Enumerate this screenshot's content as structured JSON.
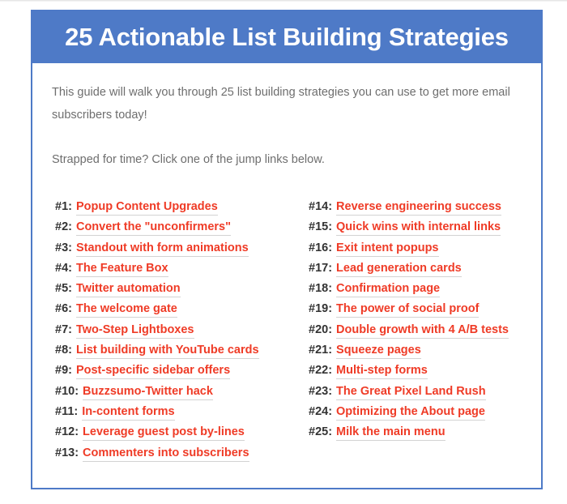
{
  "page": {
    "background_color": "#ffffff"
  },
  "card": {
    "header": {
      "title": "25 Actionable List Building Strategies",
      "background_color": "#4e7ac7",
      "text_color": "#ffffff"
    },
    "border_color": "#4e7ac7",
    "intro": {
      "paragraph_1": "This guide will walk you through 25 list building strategies you can use to get more email subscribers today!",
      "paragraph_2": "Strapped for time? Click one of the jump links below.",
      "text_color": "#6e6e6e"
    },
    "jump_links": {
      "link_color": "#ef3b26",
      "number_color": "#333333",
      "underline_color": "#d3d3d3",
      "left_column": [
        {
          "number": "#1:",
          "label": "Popup Content Upgrades"
        },
        {
          "number": "#2:",
          "label": "Convert the \"unconfirmers\""
        },
        {
          "number": "#3:",
          "label": "Standout with form animations"
        },
        {
          "number": "#4:",
          "label": "The Feature Box"
        },
        {
          "number": "#5:",
          "label": "Twitter automation"
        },
        {
          "number": "#6:",
          "label": "The welcome gate"
        },
        {
          "number": "#7:",
          "label": "Two-Step Lightboxes"
        },
        {
          "number": "#8:",
          "label": "List building with YouTube cards"
        },
        {
          "number": "#9:",
          "label": "Post-specific sidebar offers"
        },
        {
          "number": "#10:",
          "label": "Buzzsumo-Twitter hack"
        },
        {
          "number": "#11:",
          "label": "In-content forms"
        },
        {
          "number": "#12:",
          "label": "Leverage guest post by-lines"
        },
        {
          "number": "#13:",
          "label": "Commenters into subscribers"
        }
      ],
      "right_column": [
        {
          "number": "#14:",
          "label": "Reverse engineering success"
        },
        {
          "number": "#15:",
          "label": "Quick wins with internal links"
        },
        {
          "number": "#16:",
          "label": "Exit intent popups"
        },
        {
          "number": "#17:",
          "label": "Lead generation cards"
        },
        {
          "number": "#18:",
          "label": "Confirmation page"
        },
        {
          "number": "#19:",
          "label": "The power of social proof"
        },
        {
          "number": "#20:",
          "label": "Double growth with 4 A/B tests"
        },
        {
          "number": "#21:",
          "label": "Squeeze pages"
        },
        {
          "number": "#22:",
          "label": "Multi-step forms"
        },
        {
          "number": "#23:",
          "label": "The Great Pixel Land Rush"
        },
        {
          "number": "#24:",
          "label": "Optimizing the About page"
        },
        {
          "number": "#25:",
          "label": "Milk the main menu"
        }
      ]
    }
  }
}
